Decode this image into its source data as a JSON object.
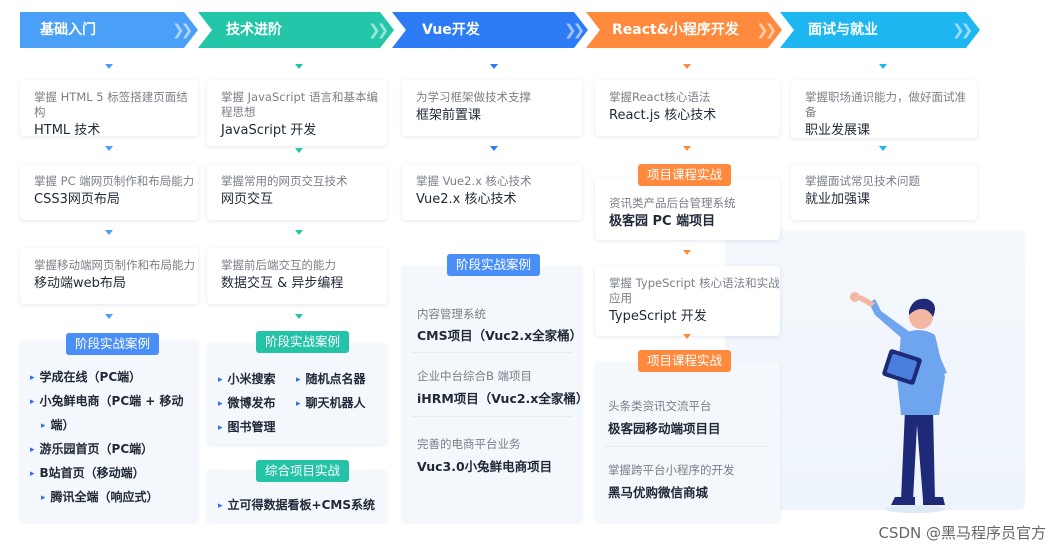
{
  "colors": {
    "stage1": "#4aa0f7",
    "stage2": "#23c6a8",
    "stage3": "#2d7cf6",
    "stage4": "#ff8a3d",
    "stage5": "#1db6f0",
    "tag_blue": "#4a8ff7",
    "tag_teal": "#24c3a8",
    "tag_orange": "#ff8a3d"
  },
  "stages": [
    "基础入门",
    "技术进阶",
    "Vue开发",
    "React&小程序开发",
    "面试与就业"
  ],
  "col1": {
    "cards": [
      {
        "desc": "掌握 HTML 5 标签搭建页面结构",
        "title": "HTML 技术"
      },
      {
        "desc": "掌握 PC 端网页制作和布局能力",
        "title": "CSS3网页布局"
      },
      {
        "desc": "掌握移动端网页制作和布局能力",
        "title": "移动端web布局"
      }
    ],
    "tag": "阶段实战案例",
    "projects": [
      "学成在线（PC端）",
      "小兔鲜电商（PC端 + 移动",
      "端）",
      "游乐园首页（PC端）",
      "B站首页（移动端）",
      "腾讯全端（响应式）"
    ]
  },
  "col2": {
    "cards": [
      {
        "desc": "掌握 JavaScript 语言和基本编",
        "desc2": "程思想",
        "title": "JavaScript 开发"
      },
      {
        "desc": "掌握常用的网页交互技术",
        "title": "网页交互"
      },
      {
        "desc": "掌握前后端交互的能力",
        "title": "数据交互 & 异步编程"
      }
    ],
    "tag": "阶段实战案例",
    "projects": [
      "小米搜索",
      "随机点名器",
      "微博发布",
      "聊天机器人",
      "图书管理"
    ],
    "tag2": "综合项目实战",
    "project2": "立可得数据看板+CMS系统"
  },
  "col3": {
    "cards": [
      {
        "desc": "为学习框架做技术支撑",
        "title": "框架前置课"
      },
      {
        "desc": "掌握 Vue2.x 核心技术",
        "title": "Vue2.x 核心技术"
      }
    ],
    "tag": "阶段实战案例",
    "projects": [
      {
        "desc": "内容管理系统",
        "title": "CMS项目（Vuc2.x全家桶）"
      },
      {
        "desc": "企业中台综合B 端项目",
        "title": "iHRM项目（Vuc2.x全家桶）"
      },
      {
        "desc": "完善的电商平台业务",
        "title": "Vuc3.0小兔鲜电商项目"
      }
    ]
  },
  "col4": {
    "card1": {
      "desc": "掌握React核心语法",
      "title": "React.js 核心技术"
    },
    "tag1": "项目课程实战",
    "proj1": {
      "desc": "资讯类产品后台管理系统",
      "title": "极客园 PC 端项目"
    },
    "card2": {
      "desc": "掌握 TypeScript 核心语法和实战",
      "desc2": "应用",
      "title": "TypeScript 开发"
    },
    "tag2": "项目课程实战",
    "proj2": {
      "desc": "头条类资讯交流平台",
      "title": "极客园移动端项目目"
    },
    "proj3": {
      "desc": "掌握跨平台小程序的开发",
      "title": "黑马优购微信商城"
    }
  },
  "col5": {
    "cards": [
      {
        "desc": "掌握职场通识能力，做好面试准",
        "desc2": "备",
        "title": "职业发展课"
      },
      {
        "desc": "掌握面试常见技术问题",
        "title": "就业加强课"
      }
    ]
  },
  "watermark": "CSDN @黑马程序员官方"
}
